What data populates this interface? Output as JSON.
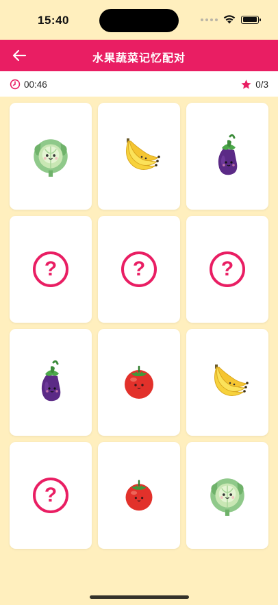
{
  "status_bar": {
    "time": "15:40",
    "icons": [
      "signal-dots-icon",
      "wifi-icon",
      "battery-icon"
    ]
  },
  "header": {
    "title": "水果蔬菜记忆配对",
    "back_icon": "arrow-left-icon",
    "bg_color": "#E91E63"
  },
  "info_bar": {
    "timer_icon": "clock-icon",
    "timer_text": "00:46",
    "score_icon": "star-icon",
    "score_text": "0/3"
  },
  "cards": [
    {
      "state": "face-up",
      "item": "cabbage"
    },
    {
      "state": "face-up",
      "item": "banana"
    },
    {
      "state": "face-up",
      "item": "eggplant"
    },
    {
      "state": "face-down",
      "symbol": "?"
    },
    {
      "state": "face-down",
      "symbol": "?"
    },
    {
      "state": "face-down",
      "symbol": "?"
    },
    {
      "state": "face-up",
      "item": "eggplant"
    },
    {
      "state": "face-up",
      "item": "tomato"
    },
    {
      "state": "face-up",
      "item": "banana"
    },
    {
      "state": "face-down",
      "symbol": "?"
    },
    {
      "state": "face-up",
      "item": "tomato"
    },
    {
      "state": "face-up",
      "item": "cabbage"
    }
  ],
  "colors": {
    "background": "#FFEFBE",
    "accent": "#E91E63",
    "card": "#FFFFFF"
  }
}
